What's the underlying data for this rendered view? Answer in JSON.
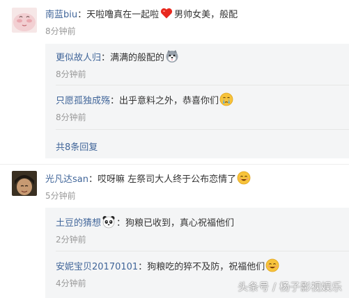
{
  "comments": [
    {
      "user": "南蓝biu",
      "colon": "：",
      "text_before": "天啦噜真在一起啦",
      "emoji": "heart-icon",
      "text_after": "男帅女美，般配",
      "time": "8分钟前",
      "replies": [
        {
          "user": "更似故人归",
          "colon": "：",
          "text": "满满的般配的",
          "emoji": "husky-icon",
          "time": "8分钟前"
        },
        {
          "user": "只愿孤独成殇",
          "colon": "：",
          "text": "出乎意料之外，恭喜你们",
          "emoji": "crying-face-icon",
          "time": "8分钟前"
        }
      ],
      "more_label": "共8条回复"
    },
    {
      "user": "光凡达san",
      "colon": "：",
      "text": "哎呀嘛 左祭司大人终于公布恋情了",
      "emoji": "smiling-face-icon",
      "time": "5分钟前",
      "replies": [
        {
          "user": "土豆的猜想",
          "user_emoji": "panda-icon",
          "colon": "：",
          "text": "狗粮已收到，真心祝福他们",
          "time": "2分钟前"
        },
        {
          "user": "安妮宝贝20170101",
          "colon": "：",
          "text": "狗粮吃的猝不及防，祝福他们",
          "emoji": "smiling-face-icon",
          "time": "4分钟前"
        }
      ]
    }
  ],
  "watermark": "头条号 / 杨子影视娱乐",
  "colors": {
    "username": "#406599",
    "text": "#333333",
    "time": "#999999",
    "reply_bg": "#f4f5f6"
  }
}
